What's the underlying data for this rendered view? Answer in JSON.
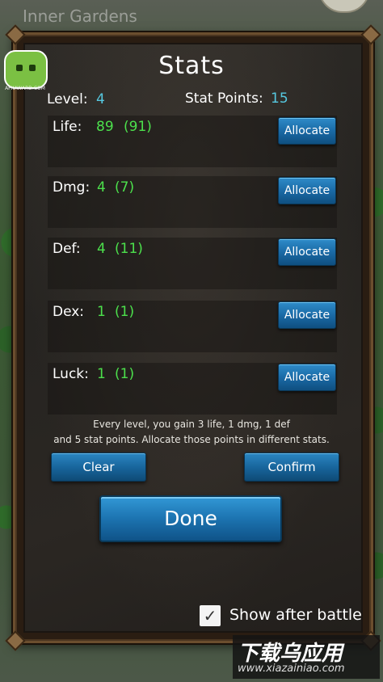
{
  "zone_title": "Inner Gardens",
  "header": {
    "title": "Stats"
  },
  "level": {
    "label": "Level:",
    "value": "4"
  },
  "stat_points": {
    "label": "Stat Points:",
    "value": "15"
  },
  "stats": [
    {
      "name": "Life:",
      "value": "89",
      "max": "(91)",
      "button": "Allocate"
    },
    {
      "name": "Dmg:",
      "value": "4",
      "max": "(7)",
      "button": "Allocate"
    },
    {
      "name": "Def:",
      "value": "4",
      "max": "(11)",
      "button": "Allocate"
    },
    {
      "name": "Dex:",
      "value": "1",
      "max": "(1)",
      "button": "Allocate"
    },
    {
      "name": "Luck:",
      "value": "1",
      "max": "(1)",
      "button": "Allocate"
    }
  ],
  "hint": {
    "line1": "Every level, you gain 3 life, 1 dmg, 1 def",
    "line2": "and 5 stat points. Allocate those points in different stats."
  },
  "buttons": {
    "clear": "Clear",
    "confirm": "Confirm",
    "done": "Done"
  },
  "show_after_battle": {
    "label": "Show after battle",
    "checked": true,
    "check_mark": "✓"
  },
  "badge": {
    "text": "APKAWARD.COM"
  },
  "watermark": {
    "title": "下载乌应用",
    "url": "www.xiazainiao.com"
  },
  "colors": {
    "accent_cyan": "#56c8e0",
    "value_green": "#4ce04c",
    "button_blue": "#1a6aa6"
  }
}
